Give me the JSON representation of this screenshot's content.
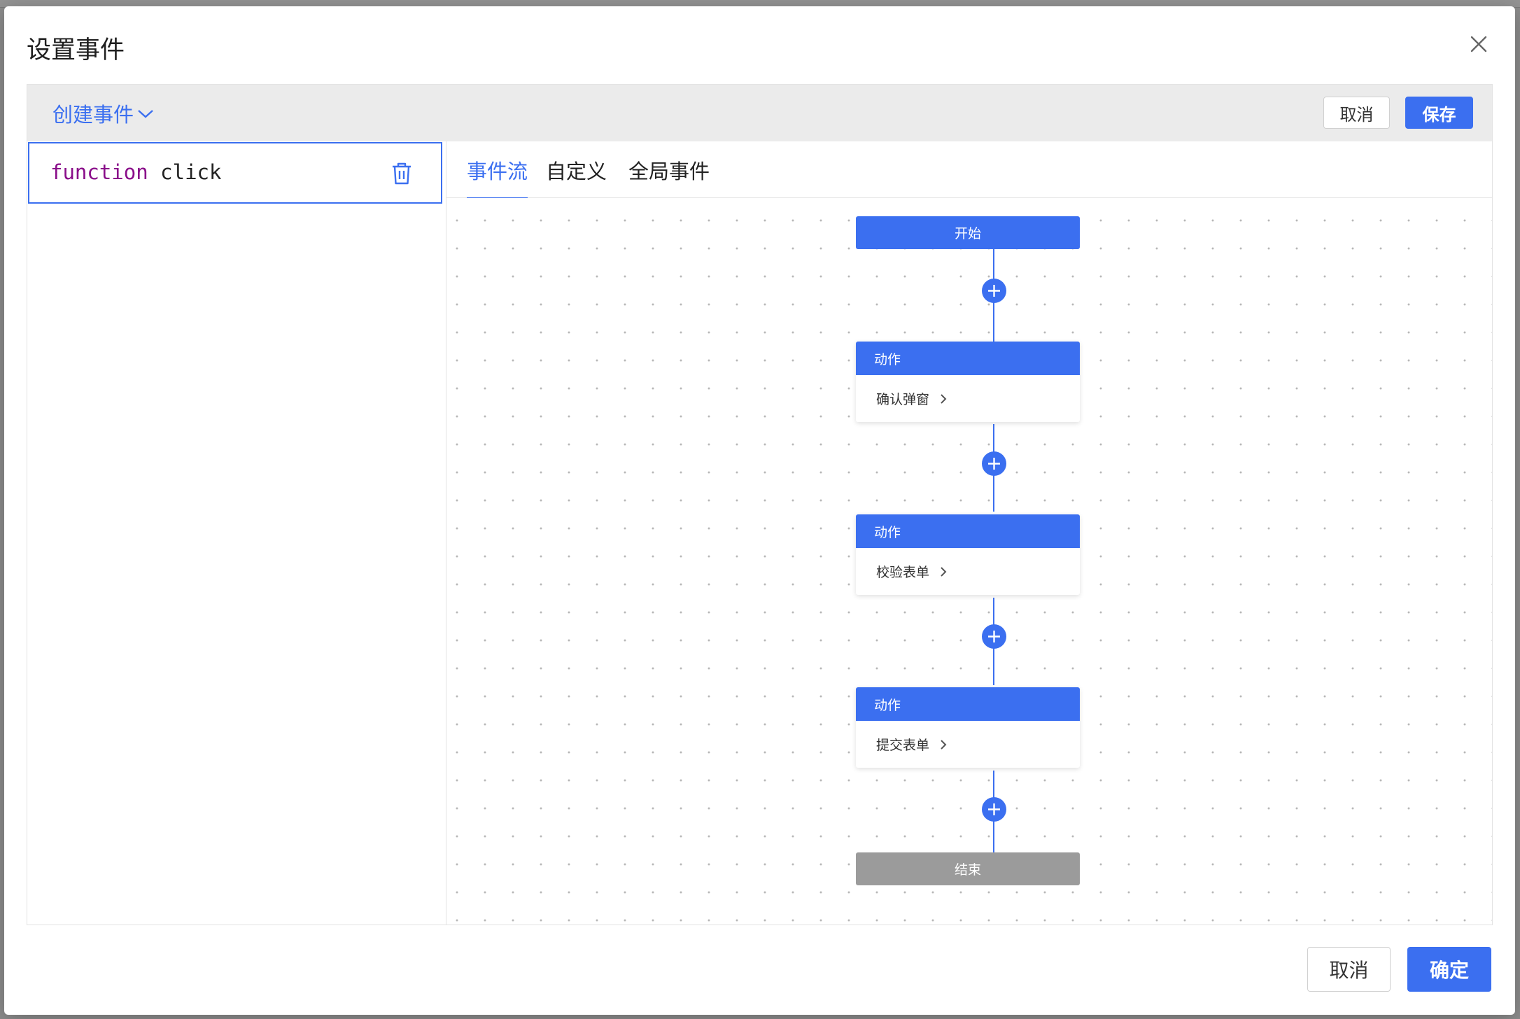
{
  "dialog": {
    "title": "设置事件",
    "close_icon": "close-icon"
  },
  "editor": {
    "create_event_label": "创建事件",
    "cancel_label": "取消",
    "save_label": "保存",
    "function_item": {
      "keyword": "function",
      "name": "click"
    },
    "tabs": [
      {
        "label": "事件流",
        "active": true
      },
      {
        "label": "自定义",
        "active": false
      },
      {
        "label": "全局事件",
        "active": false
      }
    ]
  },
  "flow": {
    "start_label": "开始",
    "end_label": "结束",
    "actions": [
      {
        "title": "动作",
        "name": "确认弹窗"
      },
      {
        "title": "动作",
        "name": "校验表单"
      },
      {
        "title": "动作",
        "name": "提交表单"
      }
    ]
  },
  "footer": {
    "cancel_label": "取消",
    "confirm_label": "确定"
  },
  "colors": {
    "accent": "#3b6ff0",
    "end_node": "#9b9b9b",
    "keyword": "#8a0e8a"
  }
}
